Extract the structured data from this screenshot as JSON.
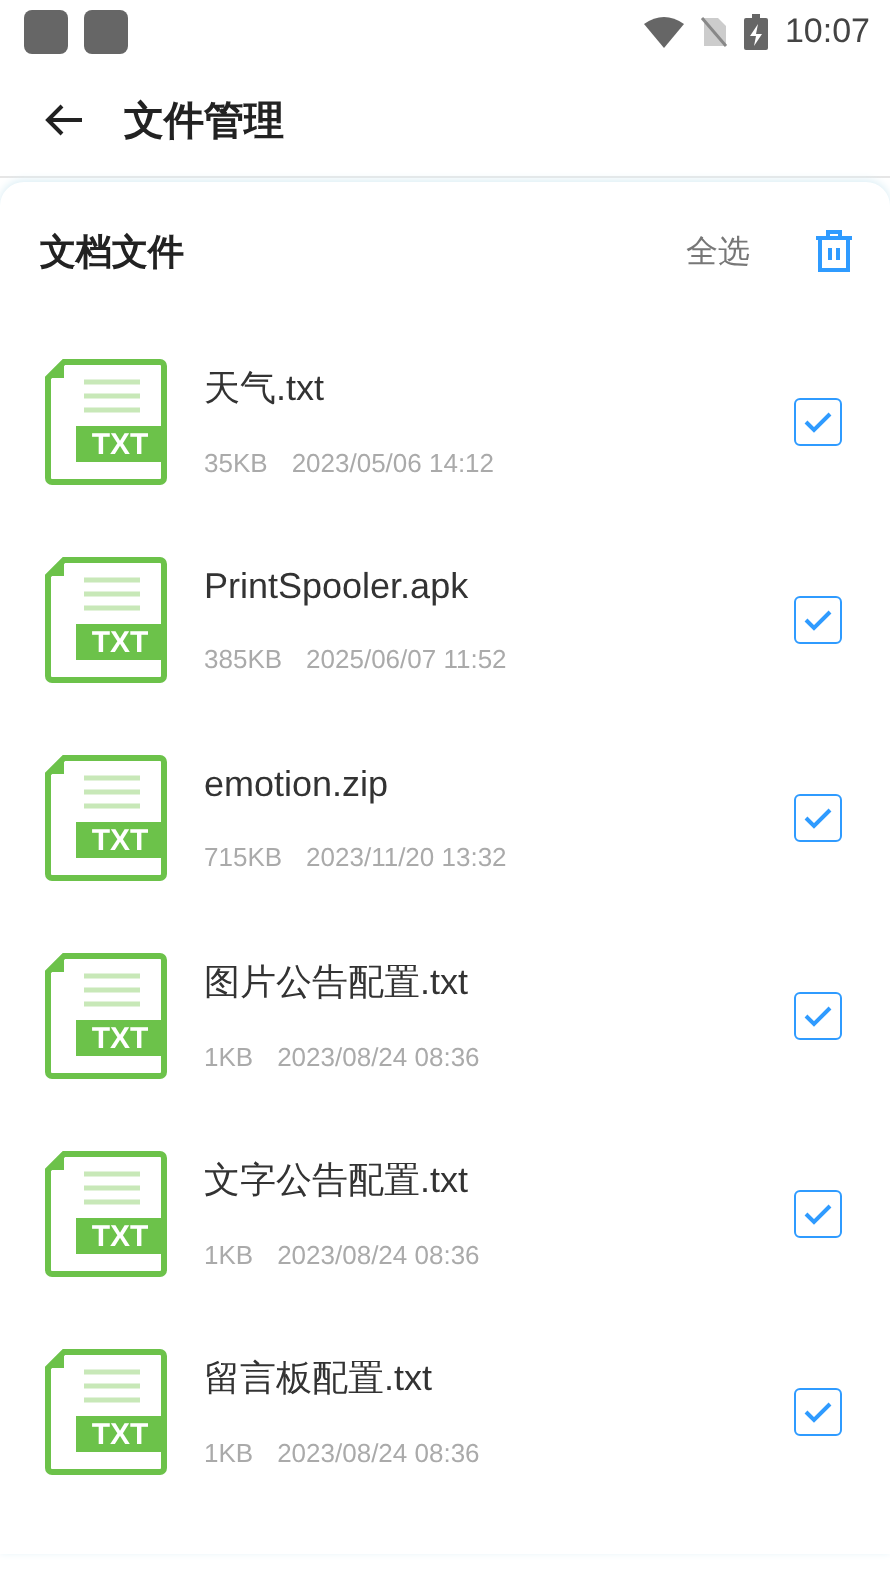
{
  "status_bar": {
    "time": "10:07"
  },
  "header": {
    "title": "文件管理"
  },
  "section": {
    "title": "文档文件",
    "select_all": "全选"
  },
  "files": [
    {
      "icon_label": "TXT",
      "name": "天气.txt",
      "size": "35KB",
      "date": "2023/05/06 14:12",
      "checked": true
    },
    {
      "icon_label": "TXT",
      "name": "PrintSpooler.apk",
      "size": "385KB",
      "date": "2025/06/07 11:52",
      "checked": true
    },
    {
      "icon_label": "TXT",
      "name": "emotion.zip",
      "size": "715KB",
      "date": "2023/11/20 13:32",
      "checked": true
    },
    {
      "icon_label": "TXT",
      "name": "图片公告配置.txt",
      "size": "1KB",
      "date": "2023/08/24 08:36",
      "checked": true
    },
    {
      "icon_label": "TXT",
      "name": "文字公告配置.txt",
      "size": "1KB",
      "date": "2023/08/24 08:36",
      "checked": true
    },
    {
      "icon_label": "TXT",
      "name": "留言板配置.txt",
      "size": "1KB",
      "date": "2023/08/24 08:36",
      "checked": true
    }
  ]
}
